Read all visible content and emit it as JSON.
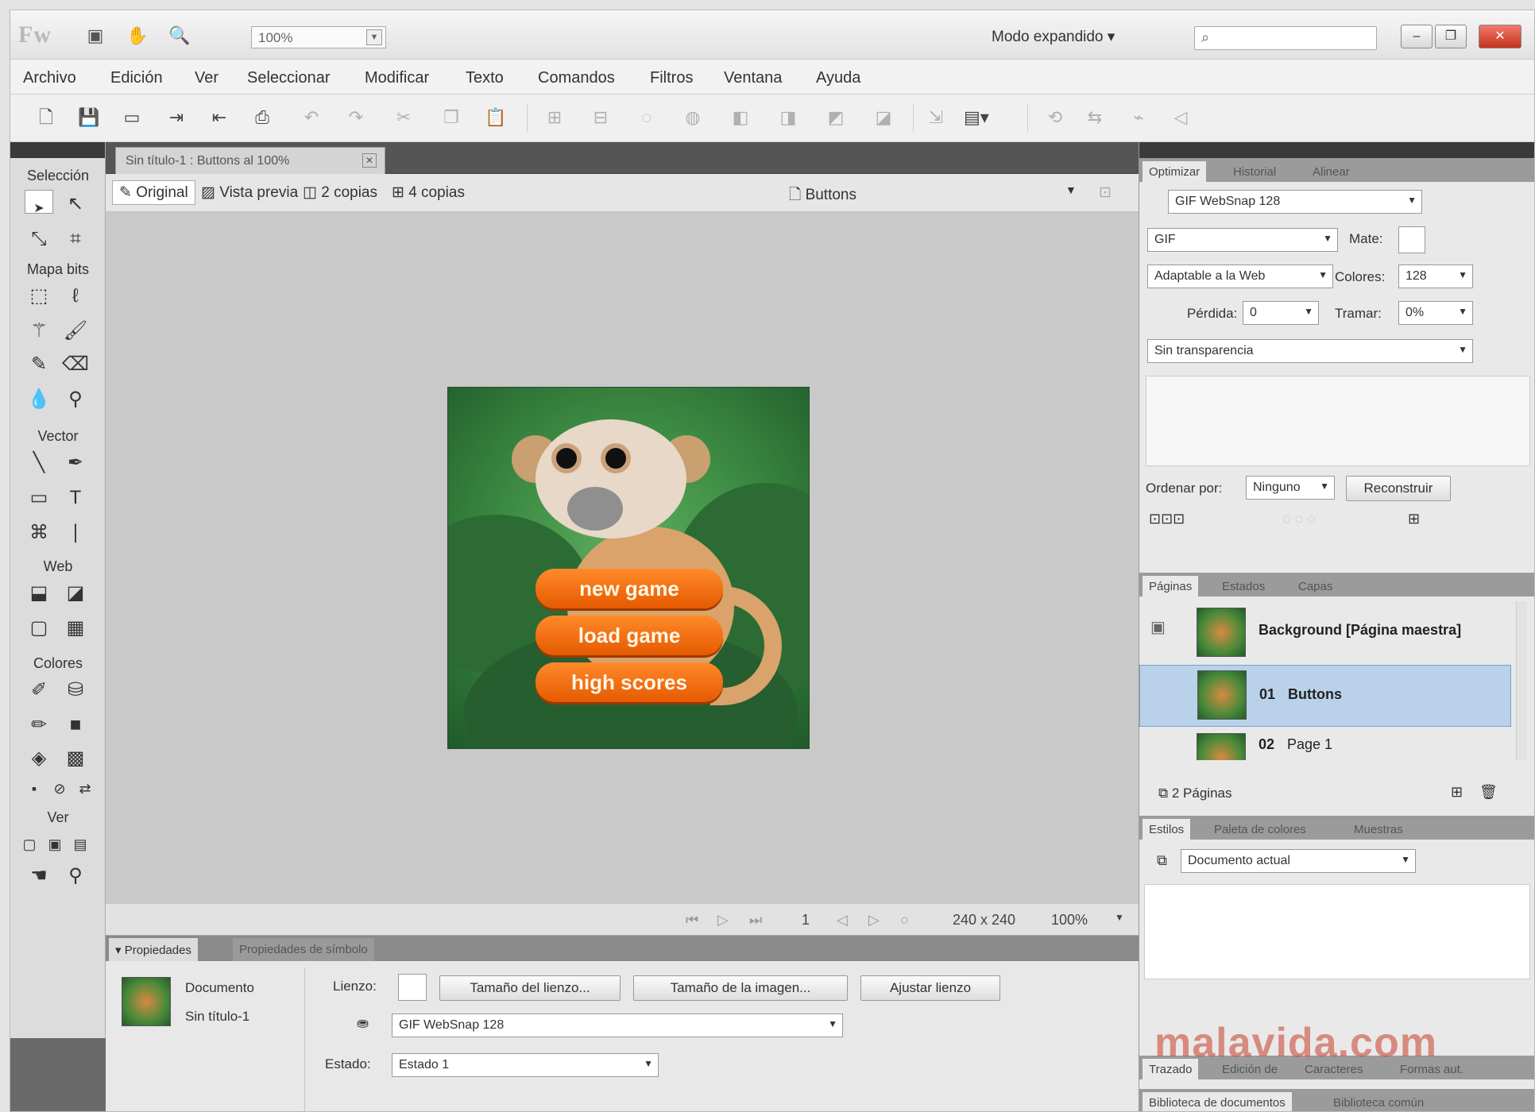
{
  "titlebar": {
    "app_logo": "Fw",
    "zoom_value": "100%",
    "mode_label": "Modo expandido",
    "search_placeholder": "",
    "window_controls": [
      "–",
      "❐",
      "✕"
    ]
  },
  "menu": [
    "Archivo",
    "Edición",
    "Ver",
    "Seleccionar",
    "Modificar",
    "Texto",
    "Comandos",
    "Filtros",
    "Ventana",
    "Ayuda"
  ],
  "toolbar_icons": [
    "new-file-icon",
    "save-icon",
    "open-icon",
    "import-icon",
    "export-icon",
    "print-icon",
    "undo-icon",
    "redo-icon",
    "cut-icon",
    "copy-icon",
    "paste-icon"
  ],
  "tools": {
    "sections": [
      "Selección",
      "Mapa bits",
      "Vector",
      "Web",
      "Colores",
      "Ver"
    ]
  },
  "document": {
    "tab_title": "Sin título-1 : Buttons al 100%",
    "views": [
      "Original",
      "Vista previa",
      "2 copias",
      "4 copias"
    ],
    "page_selector": "Buttons",
    "game_buttons": [
      "new game",
      "load game",
      "high scores"
    ],
    "status": {
      "frame": "1",
      "size": "240 x 240",
      "zoom": "100%"
    }
  },
  "properties": {
    "tabs": [
      "Propiedades",
      "Propiedades de símbolo"
    ],
    "doc_type": "Documento",
    "doc_name": "Sin título-1",
    "canvas_label": "Lienzo:",
    "btn_canvas_size": "Tamaño del lienzo...",
    "btn_image_size": "Tamaño de la imagen...",
    "btn_fit_canvas": "Ajustar lienzo",
    "export_preset": "GIF WebSnap 128",
    "state_label": "Estado:",
    "state_value": "Estado 1"
  },
  "optimize": {
    "tabs": [
      "Optimizar",
      "Historial",
      "Alinear"
    ],
    "preset": "GIF WebSnap 128",
    "format": "GIF",
    "matte_label": "Mate:",
    "palette": "Adaptable a la Web",
    "colors_label": "Colores:",
    "colors_value": "128",
    "loss_label": "Pérdida:",
    "loss_value": "0",
    "dither_label": "Tramar:",
    "dither_value": "0%",
    "transparency": "Sin transparencia",
    "sort_label": "Ordenar por:",
    "sort_value": "Ninguno",
    "rebuild": "Reconstruir"
  },
  "pages": {
    "tabs": [
      "Páginas",
      "Estados",
      "Capas"
    ],
    "items": [
      {
        "num": "",
        "name": "Background [Página maestra]"
      },
      {
        "num": "01",
        "name": "Buttons"
      },
      {
        "num": "02",
        "name": "Page 1"
      }
    ],
    "count": "2 Páginas"
  },
  "styles": {
    "tabs": [
      "Estilos",
      "Paleta de colores",
      "Muestras"
    ],
    "source": "Documento actual"
  },
  "bottom_tabs": [
    "Trazado",
    "Edición de",
    "Caracteres",
    "Formas aut."
  ],
  "bottom_tabs2": [
    "Biblioteca de documentos",
    "Biblioteca común"
  ],
  "watermark": "malavida.com"
}
